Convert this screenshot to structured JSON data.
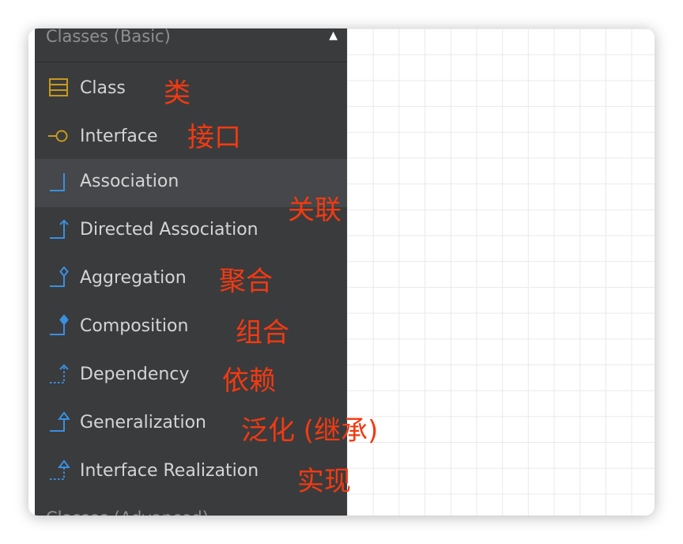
{
  "panel": {
    "title": "Classes (Basic)",
    "collapse_glyph": "▲",
    "next_section_title": "Classes (Advanced)",
    "items": [
      {
        "label": "Class",
        "icon": "class-icon"
      },
      {
        "label": "Interface",
        "icon": "interface-icon"
      },
      {
        "label": "Association",
        "icon": "association-icon"
      },
      {
        "label": "Directed Association",
        "icon": "directed-association-icon"
      },
      {
        "label": "Aggregation",
        "icon": "aggregation-icon"
      },
      {
        "label": "Composition",
        "icon": "composition-icon"
      },
      {
        "label": "Dependency",
        "icon": "dependency-icon"
      },
      {
        "label": "Generalization",
        "icon": "generalization-icon"
      },
      {
        "label": "Interface Realization",
        "icon": "interface-realization-icon"
      }
    ]
  },
  "annotations": {
    "class": "类",
    "interface": "接口",
    "association": "关联",
    "aggregation": "聚合",
    "composition": "组合",
    "dependency": "依赖",
    "generalization": "泛化 (继承)",
    "realization": "实现"
  },
  "colors": {
    "panel_bg": "#3a3b3d",
    "selected_bg": "#45474a",
    "icon_blue": "#3b8fe0",
    "icon_gold": "#c79a1d",
    "annotation_red": "#f23a11"
  }
}
